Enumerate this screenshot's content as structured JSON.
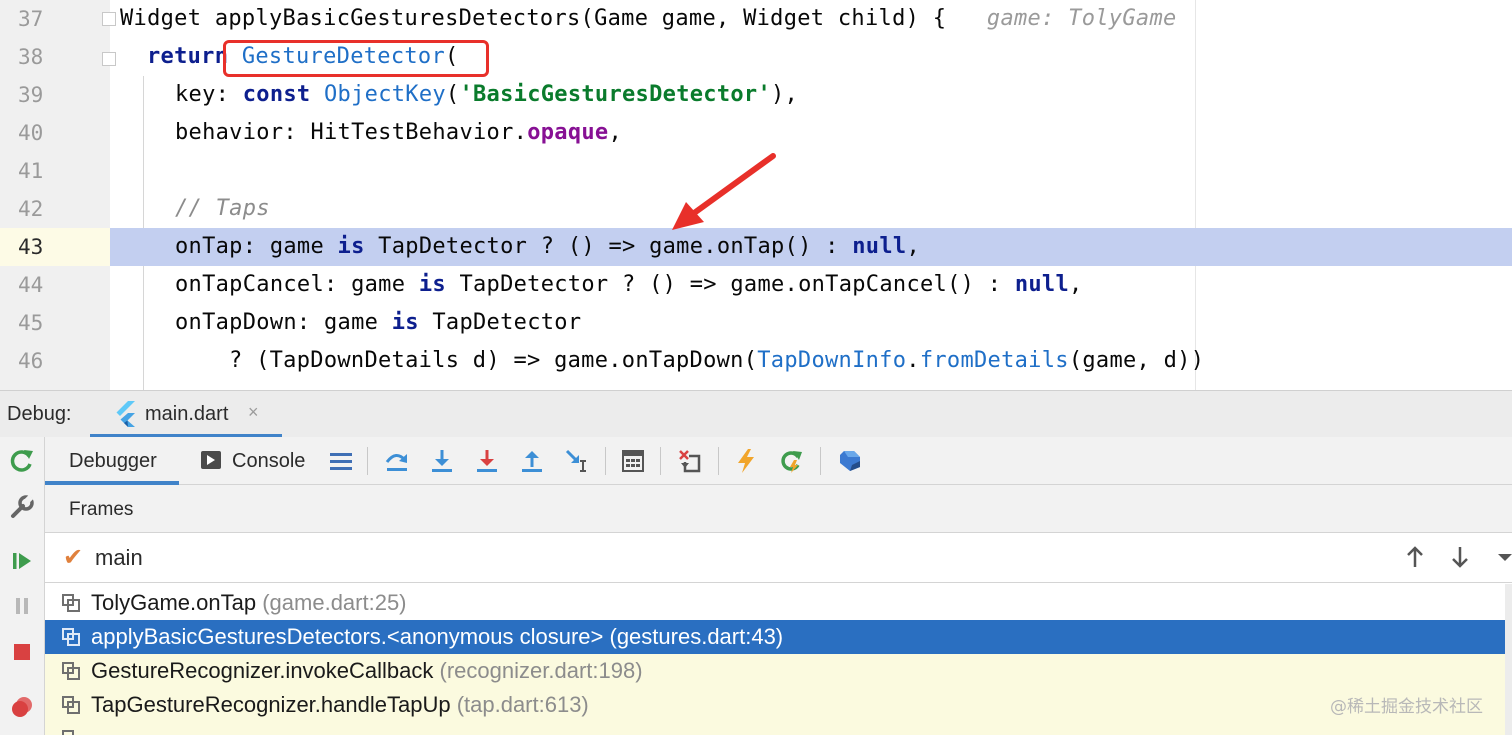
{
  "editor": {
    "lines": [
      {
        "num": "37",
        "text": "Widget applyBasicGesturesDetectors(Game game, Widget child) {",
        "hint": "game: TolyGame"
      },
      {
        "num": "38",
        "keyword": "return",
        "space": " ",
        "cls": "GestureDetector",
        "rest": "("
      },
      {
        "num": "39",
        "a": "key: ",
        "kw": "const",
        "sp": " ",
        "cls": "ObjectKey",
        "p1": "(",
        "str": "'BasicGesturesDetector'",
        "p2": "),"
      },
      {
        "num": "40",
        "a": "behavior: HitTestBehavior.",
        "prop": "opaque",
        "b": ","
      },
      {
        "num": "41"
      },
      {
        "num": "42",
        "comment": "// Taps"
      },
      {
        "num": "43",
        "a": "onTap: game ",
        "kw1": "is",
        "b": " TapDetector ? () => game.onTap() : ",
        "kw2": "null",
        "c": ","
      },
      {
        "num": "44",
        "a": "onTapCancel: game ",
        "kw1": "is",
        "b": " TapDetector ? () => game.onTapCancel() : ",
        "kw2": "null",
        "c": ","
      },
      {
        "num": "45",
        "a": "onTapDown: game ",
        "kw1": "is",
        "b": " TapDetector"
      },
      {
        "num": "46",
        "a": "? (TapDownDetails d) => game.onTapDown(",
        "cls1": "TapDownInfo",
        "dot": ".",
        "cls2": "fromDetails",
        "b": "(game, d))"
      }
    ]
  },
  "debug": {
    "label": "Debug:",
    "tab": {
      "label": "main.dart",
      "close": "×"
    },
    "tabs": {
      "debugger": "Debugger",
      "console": "Console"
    },
    "frames_header": "Frames",
    "thread": {
      "check": "✔",
      "name": "main"
    },
    "frames": [
      {
        "name": "TolyGame.onTap",
        "location": "(game.dart:25)"
      },
      {
        "name": "applyBasicGesturesDetectors.<anonymous closure>",
        "location": "(gestures.dart:43)"
      },
      {
        "name": "GestureRecognizer.invokeCallback",
        "location": "(recognizer.dart:198)"
      },
      {
        "name": "TapGestureRecognizer.handleTapUp",
        "location": "(tap.dart:613)"
      }
    ],
    "selected_frame_index": 1
  },
  "watermark": "@稀土掘金技术社区",
  "colors": {
    "selection": "#2a6fc1",
    "current_line": "#c3cff0",
    "annotation": "#e8302a",
    "library_frame": "#fbfadf"
  }
}
